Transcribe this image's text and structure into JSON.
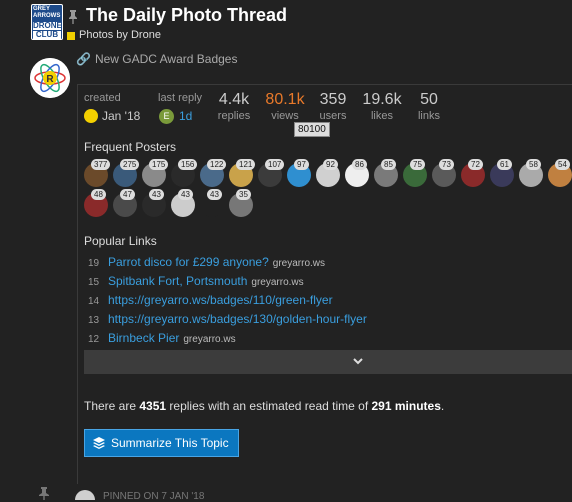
{
  "header": {
    "logo": {
      "line1": "GREY",
      "line2": "ARROWS",
      "line3": "DRONE",
      "line4": "CLUB"
    },
    "title": "The Daily Photo Thread",
    "category": "Photos by Drone",
    "category_color": "#f1d000"
  },
  "post": {
    "link_text": "New GADC Award Badges"
  },
  "summary": {
    "created_label": "created",
    "created_value": "Jan '18",
    "last_reply_label": "last reply",
    "last_reply_avatar_letter": "E",
    "last_reply_value": "1d",
    "stats": [
      {
        "num": "4.4k",
        "label": "replies",
        "color": "#cccccc"
      },
      {
        "num": "80.1k",
        "label": "views",
        "color": "#e8792a"
      },
      {
        "num": "359",
        "label": "users",
        "color": "#cccccc"
      },
      {
        "num": "19.6k",
        "label": "likes",
        "color": "#cccccc"
      },
      {
        "num": "50",
        "label": "links",
        "color": "#cccccc"
      }
    ],
    "tooltip": "80100",
    "frequent_posters_title": "Frequent Posters",
    "posters_row1": [
      "377",
      "275",
      "175",
      "156",
      "122",
      "121",
      "107",
      "97",
      "92",
      "86",
      "85",
      "75",
      "73",
      "72",
      "61",
      "58",
      "54"
    ],
    "posters_row2": [
      "48",
      "47",
      "43",
      "43",
      "43",
      "35"
    ],
    "popular_links_title": "Popular Links",
    "popular_links": [
      {
        "count": "19",
        "title": "Parrot disco for £299 anyone?",
        "domain": "greyarro.ws"
      },
      {
        "count": "15",
        "title": "Spitbank Fort, Portsmouth",
        "domain": "greyarro.ws"
      },
      {
        "count": "14",
        "title": "https://greyarro.ws/badges/110/green-flyer",
        "domain": ""
      },
      {
        "count": "13",
        "title": "https://greyarro.ws/badges/130/golden-hour-flyer",
        "domain": ""
      },
      {
        "count": "12",
        "title": "Birnbeck Pier",
        "domain": "greyarro.ws"
      }
    ],
    "read_prefix": "There are ",
    "read_replies": "4351",
    "read_mid": " replies with an estimated read time of ",
    "read_minutes": "291 minutes",
    "read_suffix": ".",
    "summarize_button": "Summarize This Topic"
  },
  "next_post": {
    "pinned_text": "PINNED ON 7 JAN '18"
  }
}
